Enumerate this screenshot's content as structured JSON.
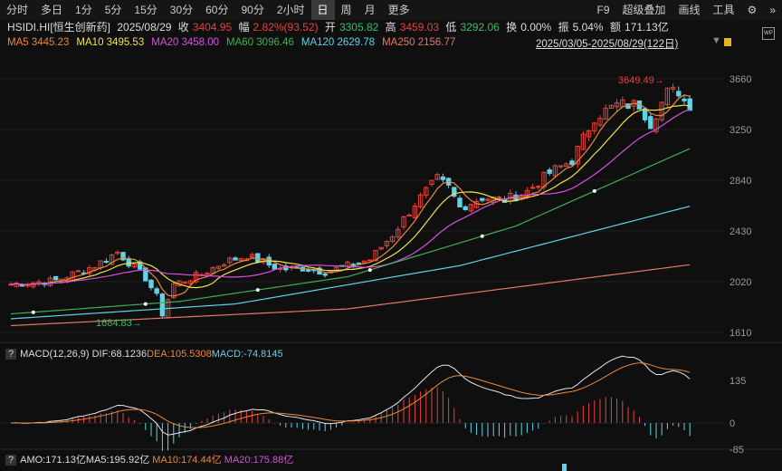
{
  "toolbar": {
    "periods": [
      "分时",
      "多日",
      "1分",
      "5分",
      "15分",
      "30分",
      "60分",
      "90分",
      "2小时",
      "日",
      "周",
      "月",
      "更多"
    ],
    "active": "日",
    "right": [
      "F9",
      "超级叠加",
      "画线",
      "工具"
    ]
  },
  "info": {
    "code": "HSIDI.HI[恒生创新药]",
    "date": "2025/08/29",
    "close_label": "收",
    "close": "3404.95",
    "amp_label": "幅",
    "change": "2.82%(93.52)",
    "open_label": "开",
    "open": "3305.82",
    "high_label": "高",
    "high": "3459.03",
    "low_label": "低",
    "low": "3292.06",
    "turnover_label": "换",
    "turnover": "0.00%",
    "swing_label": "振",
    "swing": "5.04%",
    "amount_label": "额",
    "amount": "171.13亿"
  },
  "ma": [
    {
      "label": "MA5 3445.23",
      "color": "#e8893a"
    },
    {
      "label": "MA10 3495.53",
      "color": "#f2e14a"
    },
    {
      "label": "MA20 3458.00",
      "color": "#d94fe0"
    },
    {
      "label": "MA60 3096.46",
      "color": "#3fae55"
    },
    {
      "label": "MA120 2629.78",
      "color": "#5fd3e8"
    },
    {
      "label": "MA250 2156.77",
      "color": "#e07a6a"
    }
  ],
  "range": "2025/03/05-2025/08/29(122日)",
  "price_axis": [
    "3660",
    "3250",
    "2840",
    "2430",
    "2020",
    "1610"
  ],
  "annotations": {
    "high": "3649.49",
    "low": "1684.83"
  },
  "macd": {
    "q": "?",
    "title": "MACD(12,26,9)",
    "dif": "DIF:68.1236",
    "dea": "DEA:105.5308",
    "macd": "MACD:-74.8145",
    "axis": [
      "135",
      "0",
      "-85"
    ]
  },
  "amo": {
    "q": "?",
    "amo": "AMO:171.13亿",
    "ma5": "MA5:195.92亿",
    "ma10": "MA10:174.44亿",
    "ma20": "MA20:175.88亿"
  },
  "chart_data": {
    "type": "candlestick",
    "close_keypoints": [
      [
        0,
        2000
      ],
      [
        8,
        2030
      ],
      [
        15,
        2150
      ],
      [
        19,
        2260
      ],
      [
        24,
        2050
      ],
      [
        26,
        1900
      ],
      [
        27,
        1760
      ],
      [
        29,
        2000
      ],
      [
        34,
        2080
      ],
      [
        38,
        2180
      ],
      [
        42,
        2230
      ],
      [
        48,
        2120
      ],
      [
        52,
        2130
      ],
      [
        56,
        2100
      ],
      [
        60,
        2150
      ],
      [
        64,
        2200
      ],
      [
        68,
        2400
      ],
      [
        72,
        2650
      ],
      [
        76,
        2850
      ],
      [
        78,
        2780
      ],
      [
        80,
        2620
      ],
      [
        84,
        2700
      ],
      [
        88,
        2680
      ],
      [
        92,
        2750
      ],
      [
        96,
        2900
      ],
      [
        100,
        3000
      ],
      [
        104,
        3350
      ],
      [
        108,
        3450
      ],
      [
        112,
        3450
      ],
      [
        114,
        3300
      ],
      [
        117,
        3550
      ],
      [
        119,
        3560
      ],
      [
        121,
        3405
      ]
    ],
    "ma60": [
      [
        0,
        1760
      ],
      [
        30,
        1860
      ],
      [
        60,
        2060
      ],
      [
        90,
        2470
      ],
      [
        121,
        3096
      ]
    ],
    "ma120": [
      [
        0,
        1720
      ],
      [
        40,
        1840
      ],
      [
        80,
        2150
      ],
      [
        121,
        2630
      ]
    ],
    "ma250": [
      [
        0,
        1665
      ],
      [
        60,
        1800
      ],
      [
        121,
        2157
      ]
    ],
    "ylim": [
      1610,
      3660
    ]
  }
}
